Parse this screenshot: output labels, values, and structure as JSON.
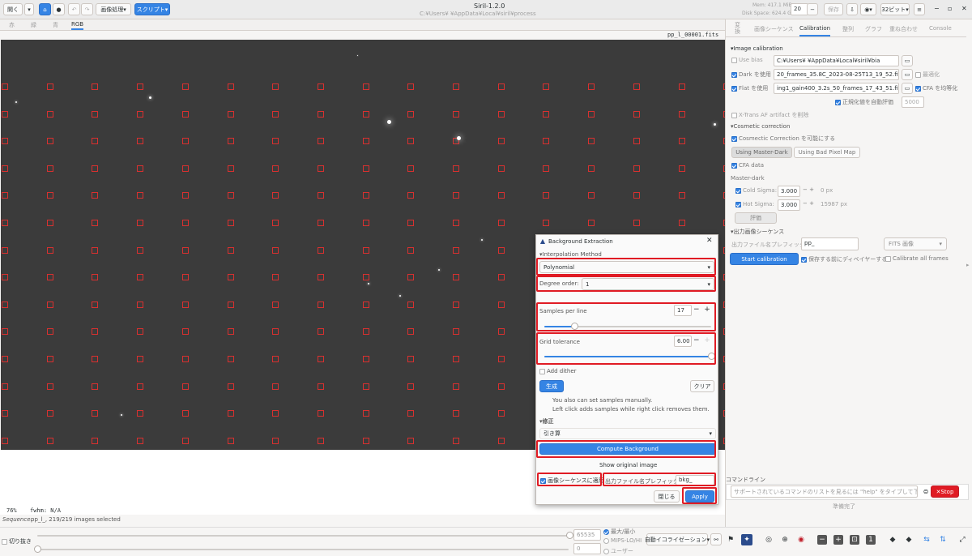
{
  "titlebar": {
    "title": "Siril-1.2.0",
    "path": "C:¥Users¥    ¥AppData¥Local¥siril¥process",
    "mem": "Mem: 417.1 MiB",
    "disk": "Disk Space: 624.4 GB",
    "thread_count": "20",
    "open_label": "開く",
    "image_processing_label": "画像処理▾",
    "scripts_label": "スクリプト▾",
    "save_label": "保存",
    "bit_label": "32ビット▾"
  },
  "viewer_tabs": [
    "赤",
    "緑",
    "青",
    "RGB"
  ],
  "viewer": {
    "filename": "pp_l_00001.fits",
    "zoom": "76%",
    "fwhm": "fwhm: N/A"
  },
  "status": {
    "sequence_label": "Sequence:",
    "sequence_value": "pp_l_, 219/219 images selected",
    "crop_label": "切り抜き",
    "max_value": "65535",
    "min_value": "0",
    "mode_options": [
      "最大/最小",
      "MIPS-LO/HI",
      "ユーザー"
    ],
    "autostretch_label": "自動イコライゼーション▾"
  },
  "right_tabs": [
    "変換",
    "画像シーケンス",
    "Calibration",
    "整列",
    "グラフ",
    "重ね合わせ",
    "Console"
  ],
  "right_tabs_active": "Calibration",
  "calibration": {
    "image_calibration": "▾Image calibration",
    "use_bias": "Use bias",
    "bias_path": "C:¥Users¥     ¥AppData¥Local¥siril¥bia",
    "use_dark": "Dark を使用",
    "dark_path": "20_frames_35.8C_2023-08-25T13_19_52.fits",
    "optimize": "最適化",
    "use_flat": "Flat を使用",
    "flat_path": "ing1_gain400_3.2s_50_frames_17_43_51.fits",
    "cfa_equalize": "CFA を均等化",
    "auto_norm": "正規化値を自動評価",
    "norm_value": "5000",
    "xtrans": "X-Trans AF artifact を削除",
    "cosmetic": "▾Cosmetic correction",
    "cosmetic_enable": "Cosmectic Correction を可能にする",
    "using_master_dark": "Using Master-Dark",
    "using_bad_pixel": "Using Bad Pixel Map",
    "cfa_data": "CFA data",
    "master_dark": "Master-dark",
    "cold_sigma": "Cold Sigma:",
    "cold_value": "3.000",
    "cold_px": "0 px",
    "hot_sigma": "Hot Sigma:",
    "hot_value": "3.000",
    "hot_px": "15987 px",
    "evaluate": "評価",
    "output_seq": "▾出力画像シーケンス",
    "prefix_label": "出力ファイル名プレフィックス:",
    "prefix_value": "pp_",
    "fits_format": "FITS 画像",
    "start_calibration": "Start calibration",
    "debayer": "保存する前にディベイヤーする",
    "calibrate_all": "Calibrate all frames"
  },
  "command": {
    "label": "コマンドライン",
    "placeholder": "サポートされているコマンドのリストを見るには \"help\" をタイプして下さい",
    "stop": "Stop",
    "status": "準備完了"
  },
  "dialog": {
    "title": "Background Extraction",
    "interp_header": "▾Interpolation Method",
    "method": "Polynomial",
    "degree_label": "Degree order:",
    "degree_value": "1",
    "samples_label": "Samples per line",
    "samples_value": "17",
    "samples_fraction": 0.18,
    "grid_label": "Grid tolerance",
    "grid_value": "6.00",
    "grid_fraction": 1.0,
    "add_dither": "Add dither",
    "generate": "生成",
    "clear": "クリア",
    "hint1": "You also can set samples manually.",
    "hint2": "Left click adds samples while right click removes them.",
    "correction_header": "▾修正",
    "correction_value": "引き算",
    "compute": "Compute Background",
    "show_original": "Show original image",
    "apply_seq": "画像シーケンスに適用",
    "prefix_label": "出力ファイル名プレフィックス:",
    "prefix_value": "bkg_",
    "close": "閉じる",
    "apply": "Apply"
  }
}
